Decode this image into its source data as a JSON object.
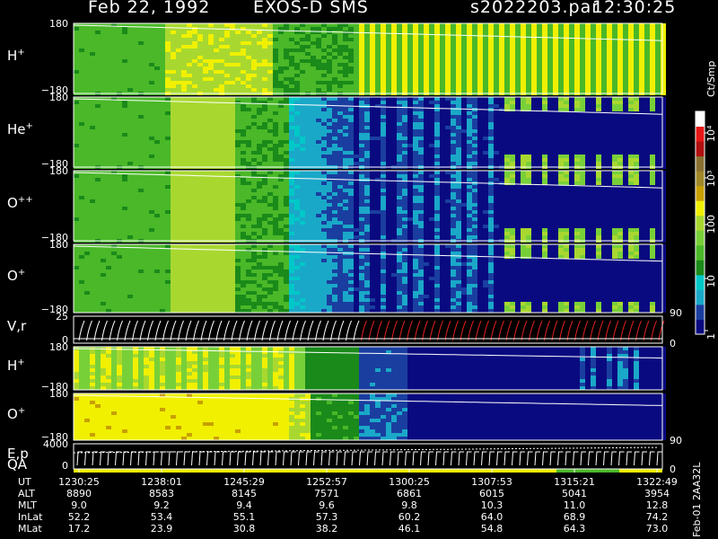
{
  "header": {
    "date": "Feb 22, 1992",
    "instrument": "EXOS-D SMS",
    "file": "s2022203.par",
    "time": "12:30:25"
  },
  "chart_data": {
    "type": "heatmap",
    "panels": [
      {
        "label": "H+",
        "ion": "H",
        "charge": "+",
        "ymax": "180",
        "ymin": "−180"
      },
      {
        "label": "He+",
        "ion": "He",
        "charge": "+",
        "ymax": "180",
        "ymin": "−180"
      },
      {
        "label": "O++",
        "ion": "O",
        "charge": "++",
        "ymax": "180",
        "ymin": "−180"
      },
      {
        "label": "O+",
        "ion": "O",
        "charge": "+",
        "ymax": "180",
        "ymin": "−180",
        "right_tick": "90"
      },
      {
        "label": "V,r",
        "ymax": "25",
        "ymin": "0",
        "right_tick": "0"
      },
      {
        "label": "H+",
        "ion": "H",
        "charge": "+",
        "ymax": "180",
        "ymin": "−180"
      },
      {
        "label": "O+",
        "ion": "O",
        "charge": "+",
        "ymax": "180",
        "ymin": "−180",
        "right_tick": "90"
      },
      {
        "label": "E,p",
        "ymax": "4000",
        "ymin": "0",
        "right_tick": "0"
      }
    ],
    "qa_label": "QA",
    "colorbar": {
      "unit": "Ct/Smp",
      "ticks": [
        "10⁴",
        "10³",
        "100",
        "10",
        "1"
      ],
      "colors": [
        "#0a0a80",
        "#1a3ea0",
        "#1aa8c8",
        "#00c8c8",
        "#1a8a1a",
        "#4ab828",
        "#78d038",
        "#a8d830",
        "#f0f000",
        "#c8a000",
        "#a08828",
        "#8a7030",
        "#b01010",
        "#e81818",
        "#ffffff"
      ]
    },
    "time_axis": {
      "rows": [
        {
          "label": "UT",
          "values": [
            "1230:25",
            "1238:01",
            "1245:29",
            "1252:57",
            "1300:25",
            "1307:53",
            "1315:21",
            "1322:49"
          ]
        },
        {
          "label": "ALT",
          "values": [
            "8890",
            "8583",
            "8145",
            "7571",
            "6861",
            "6015",
            "5041",
            "3954"
          ]
        },
        {
          "label": "MLT",
          "values": [
            "9.0",
            "9.2",
            "9.4",
            "9.6",
            "9.8",
            "10.3",
            "11.0",
            "12.8"
          ]
        },
        {
          "label": "InLat",
          "values": [
            "52.2",
            "53.4",
            "55.1",
            "57.3",
            "60.2",
            "64.0",
            "68.9",
            "74.2"
          ]
        },
        {
          "label": "MLat",
          "values": [
            "17.2",
            "23.9",
            "30.8",
            "38.2",
            "46.1",
            "54.8",
            "64.3",
            "73.0"
          ]
        }
      ]
    }
  },
  "side_label": "Feb-01 2AA32L",
  "colors": {
    "background": "#000000",
    "text": "#ffffff",
    "trace": "#ffffff",
    "qa_bar": "#f0f000"
  }
}
